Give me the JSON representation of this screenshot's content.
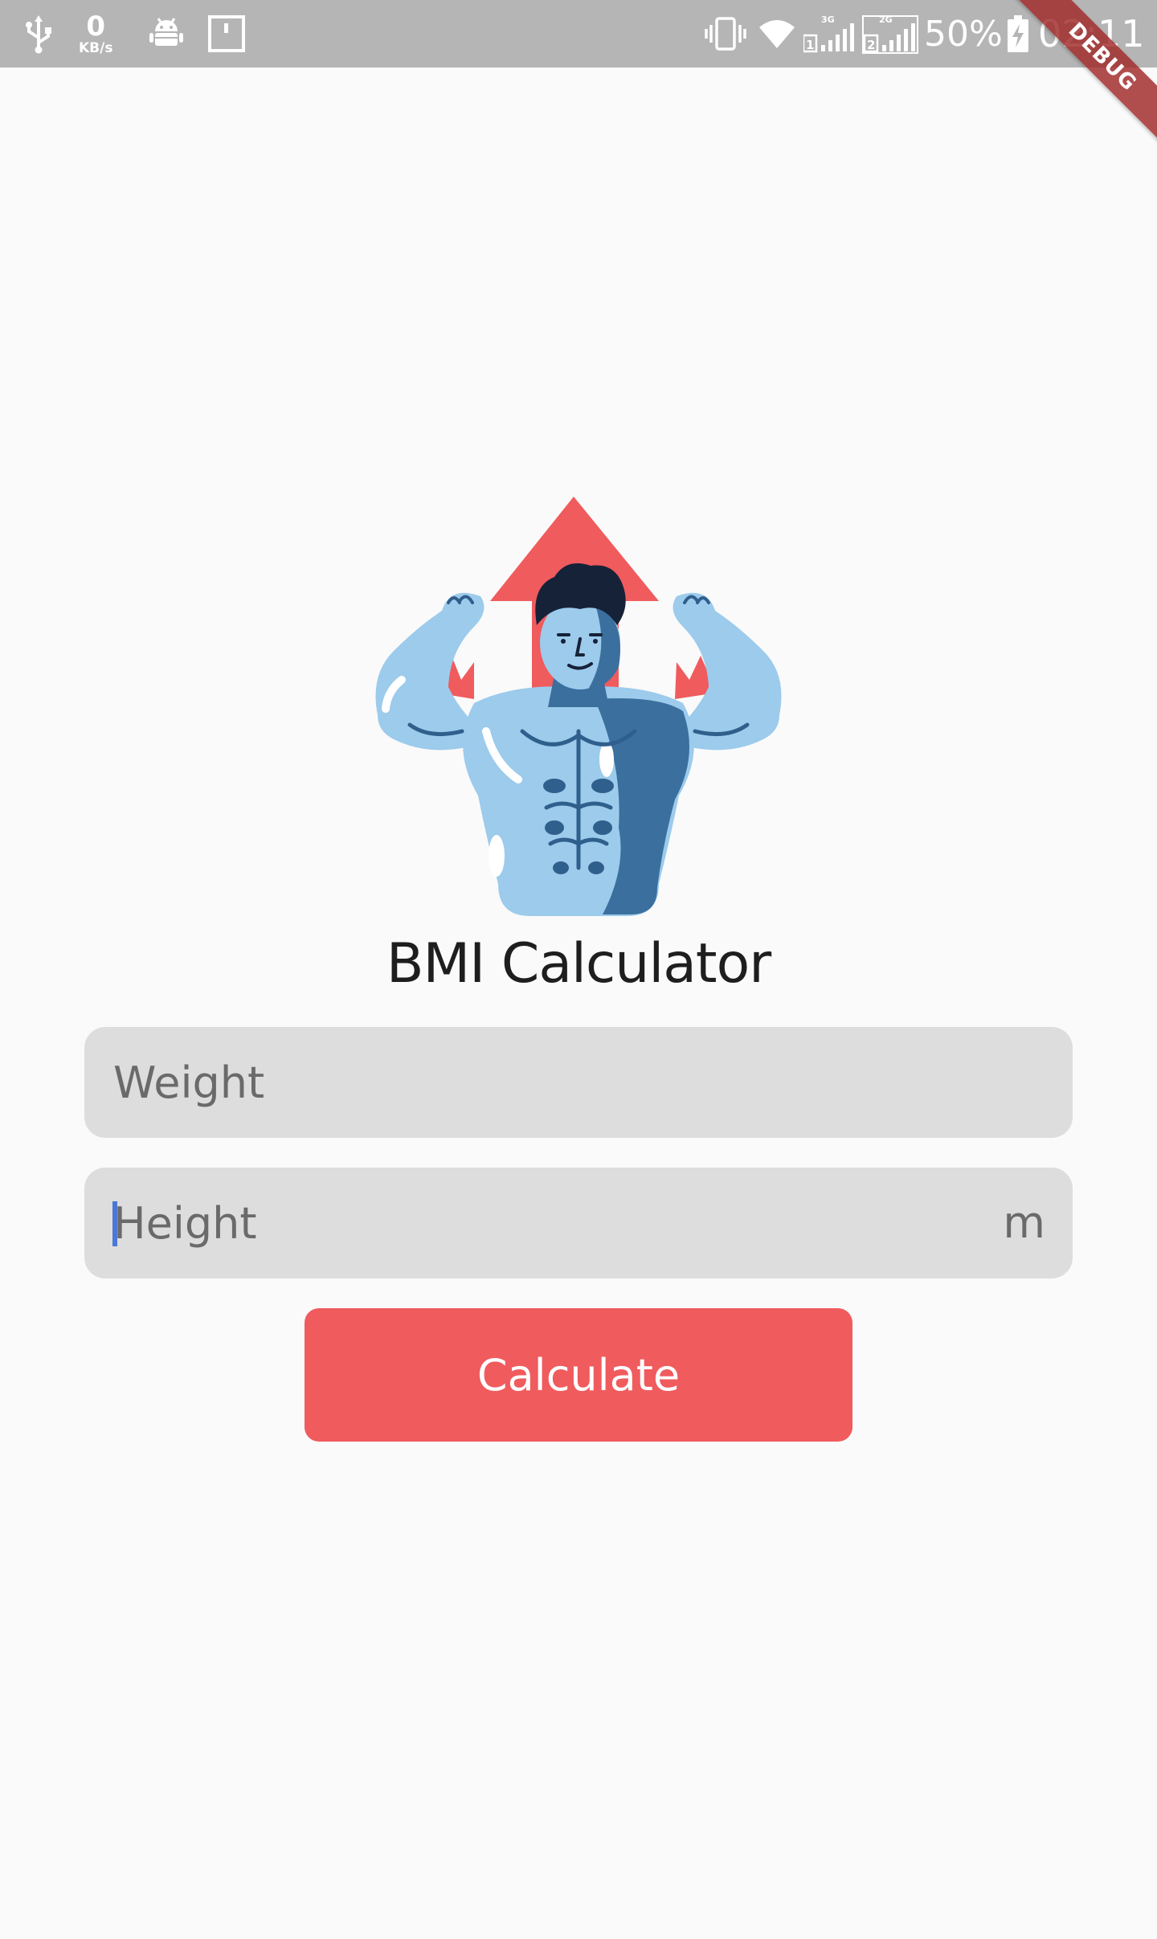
{
  "status_bar": {
    "network_speed_value": "0",
    "network_speed_unit": "KB/s",
    "sim1_network": "3G",
    "sim2_network": "2G",
    "battery_percent": "50%",
    "time": "02:11"
  },
  "debug_banner": "DEBUG",
  "main": {
    "title": "BMI Calculator",
    "weight": {
      "placeholder": "Weight",
      "value": ""
    },
    "height": {
      "placeholder": "Height",
      "value": "",
      "suffix": "m"
    },
    "calculate_label": "Calculate"
  },
  "colors": {
    "accent": "#f05b5e",
    "field_background": "#dddddd",
    "body_blue": "#9ccbec",
    "shadow_blue": "#3b6f9e"
  }
}
